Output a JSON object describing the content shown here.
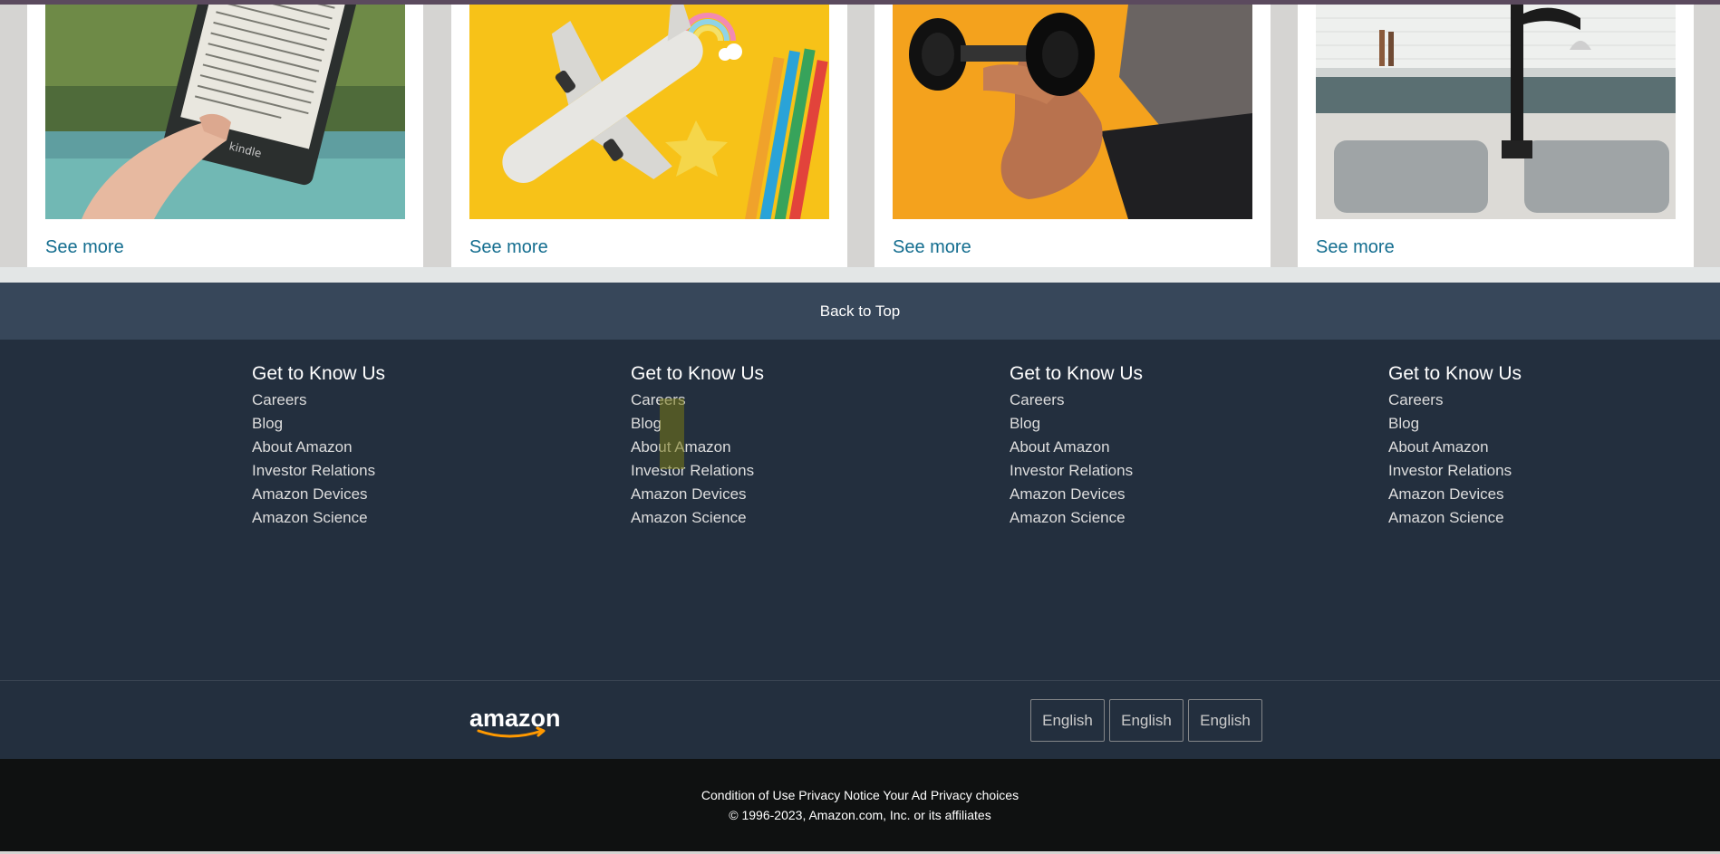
{
  "cards": [
    {
      "image": "kindle-reader-photo",
      "link": "See more"
    },
    {
      "image": "toy-airplane-pencils-photo",
      "link": "See more"
    },
    {
      "image": "dumbbell-workout-photo",
      "link": "See more"
    },
    {
      "image": "kitchen-sink-faucet-photo",
      "link": "See more"
    }
  ],
  "back_to_top": "Back to Top",
  "footer_columns": [
    {
      "heading": "Get to Know Us",
      "links": [
        "Careers",
        "Blog",
        "About Amazon",
        "Investor Relations",
        "Amazon Devices",
        "Amazon Science"
      ]
    },
    {
      "heading": "Get to Know Us",
      "links": [
        "Careers",
        "Blog",
        "About Amazon",
        "Investor Relations",
        "Amazon Devices",
        "Amazon Science"
      ]
    },
    {
      "heading": "Get to Know Us",
      "links": [
        "Careers",
        "Blog",
        "About Amazon",
        "Investor Relations",
        "Amazon Devices",
        "Amazon Science"
      ]
    },
    {
      "heading": "Get to Know Us",
      "links": [
        "Careers",
        "Blog",
        "About Amazon",
        "Investor Relations",
        "Amazon Devices",
        "Amazon Science"
      ]
    }
  ],
  "logo_text": "amazon",
  "language_buttons": [
    "English",
    "English",
    "English"
  ],
  "legal": {
    "condition_of_use": "Condition of Use",
    "privacy_notice": "Privacy Notice",
    "your_ad_privacy": "Your Ad Privacy choices",
    "copyright": "© 1996-2023, Amazon.com, Inc. or its affiliates"
  },
  "colors": {
    "link_blue": "#136d8f",
    "back_to_top_bg": "#37475a",
    "footer_bg": "#232f3e",
    "legal_bg": "#0f1111",
    "logo_smile": "#ff9900"
  }
}
